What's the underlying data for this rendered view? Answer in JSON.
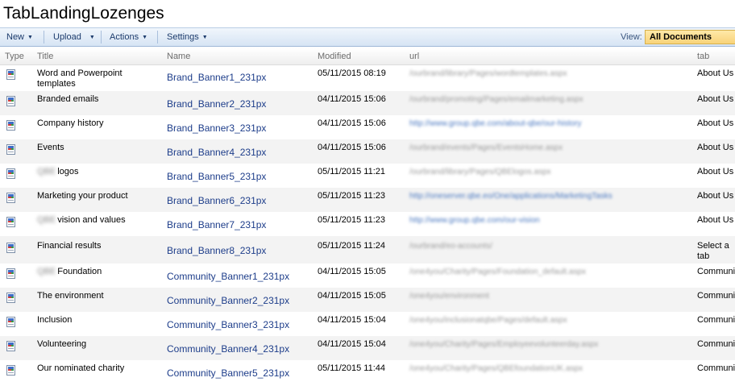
{
  "page_title": "TabLandingLozenges",
  "toolbar": {
    "new_label": "New",
    "upload_label": "Upload",
    "actions_label": "Actions",
    "settings_label": "Settings",
    "view_label": "View:",
    "view_value": "All Documents"
  },
  "columns": {
    "type": "Type",
    "title": "Title",
    "name": "Name",
    "modified": "Modified",
    "url": "url",
    "tab": "tab"
  },
  "rows": [
    {
      "prefix": "",
      "title": "Word and Powerpoint templates",
      "name": "Brand_Banner1_231px",
      "modified": "05/11/2015 08:19",
      "url": "/ourbrand/library/Pages/wordtemplates.aspx",
      "tab": "About Us"
    },
    {
      "prefix": "",
      "title": "Branded emails",
      "name": "Brand_Banner2_231px",
      "modified": "04/11/2015 15:06",
      "url": "/ourbrand/promoting/Pages/emailmarketing.aspx",
      "tab": "About Us"
    },
    {
      "prefix": "",
      "title": "Company history",
      "name": "Brand_Banner3_231px",
      "modified": "04/11/2015 15:06",
      "url": "http://www.group.qbe.com/about-qbe/our-history",
      "tab": "About Us"
    },
    {
      "prefix": "",
      "title": "Events",
      "name": "Brand_Banner4_231px",
      "modified": "04/11/2015 15:06",
      "url": "/ourbrand/events/Pages/EventsHome.aspx",
      "tab": "About Us"
    },
    {
      "prefix": "QBE",
      "title": "logos",
      "name": "Brand_Banner5_231px",
      "modified": "05/11/2015 11:21",
      "url": "/ourbrand/library/Pages/QBElogos.aspx",
      "tab": "About Us"
    },
    {
      "prefix": "",
      "title": "Marketing your product",
      "name": "Brand_Banner6_231px",
      "modified": "05/11/2015 11:23",
      "url": "http://oneserver.qbe.eo/One/applications/MarketingTasks",
      "tab": "About Us"
    },
    {
      "prefix": "QBE",
      "title": "vision and values",
      "name": "Brand_Banner7_231px",
      "modified": "05/11/2015 11:23",
      "url": "http://www.group.qbe.com/our-vision",
      "tab": "About Us"
    },
    {
      "prefix": "",
      "title": "Financial results",
      "name": "Brand_Banner8_231px",
      "modified": "05/11/2015 11:24",
      "url": "/ourbrand/eo-accounts/",
      "tab": "Select a tab"
    },
    {
      "prefix": "QBE",
      "title": "Foundation",
      "name": "Community_Banner1_231px",
      "modified": "04/11/2015 15:05",
      "url": "/one4you/Charity/Pages/Foundation_default.aspx",
      "tab": "Community"
    },
    {
      "prefix": "",
      "title": "The environment",
      "name": "Community_Banner2_231px",
      "modified": "04/11/2015 15:05",
      "url": "/one4you/environment",
      "tab": "Community"
    },
    {
      "prefix": "",
      "title": "Inclusion",
      "name": "Community_Banner3_231px",
      "modified": "04/11/2015 15:04",
      "url": "/one4you/inclusionatqbe/Pages/default.aspx",
      "tab": "Community"
    },
    {
      "prefix": "",
      "title": "Volunteering",
      "name": "Community_Banner4_231px",
      "modified": "04/11/2015 15:04",
      "url": "/one4you/Charity/Pages/Employeevolunteerday.aspx",
      "tab": "Community"
    },
    {
      "prefix": "",
      "title": "Our nominated charity",
      "name": "Community_Banner5_231px",
      "modified": "05/11/2015 11:44",
      "url": "/one4you/Charity/Pages/QBEfoundationUK.aspx",
      "tab": "Community"
    }
  ]
}
